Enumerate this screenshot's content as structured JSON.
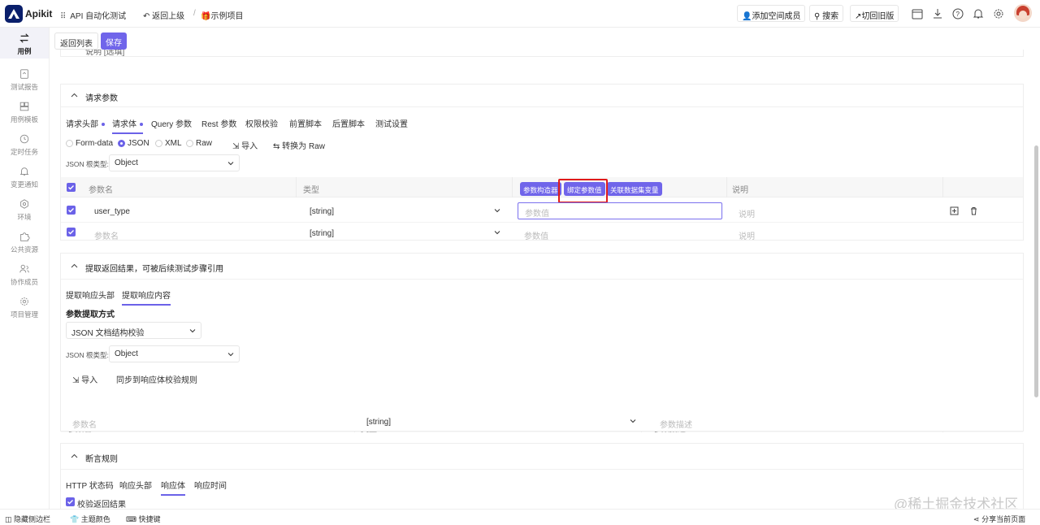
{
  "app": {
    "brand": "Apikit",
    "project": "API 自动化测试",
    "back_up": "返回上级",
    "breadcrumb": "示例项目"
  },
  "topbar": {
    "add_member": "添加空间成员",
    "search": "搜索",
    "switch_old": "切回旧版"
  },
  "sidebar": {
    "items": [
      {
        "label": "用例",
        "icon": "swap-icon"
      },
      {
        "label": "测试报告",
        "icon": "report-icon"
      },
      {
        "label": "用例模板",
        "icon": "template-icon"
      },
      {
        "label": "定时任务",
        "icon": "clock-icon"
      },
      {
        "label": "变更通知",
        "icon": "bell-icon"
      },
      {
        "label": "环境",
        "icon": "environment-icon"
      },
      {
        "label": "公共资源",
        "icon": "puzzle-icon"
      },
      {
        "label": "协作成员",
        "icon": "users-icon"
      },
      {
        "label": "项目管理",
        "icon": "settings-icon"
      }
    ]
  },
  "actions": {
    "back_list": "返回列表",
    "save": "保存"
  },
  "desc_section": {
    "title": "说明 [选填]"
  },
  "request_params": {
    "title": "请求参数",
    "tabs": [
      "请求头部",
      "请求体",
      "Query 参数",
      "Rest 参数",
      "权限校验",
      "前置脚本",
      "后置脚本",
      "测试设置"
    ],
    "body_types": [
      "Form-data",
      "JSON",
      "XML",
      "Raw"
    ],
    "import": "导入",
    "convert_raw": "转换为 Raw",
    "root_type_label": "JSON 根类型:",
    "root_type_value": "Object",
    "columns": {
      "name": "参数名",
      "type": "类型",
      "desc": "说明"
    },
    "value_buttons": [
      "参数构造器",
      "绑定参数值",
      "关联数据集变量"
    ],
    "rows": [
      {
        "name": "user_type",
        "type": "[string]",
        "value_placeholder": "参数值",
        "desc": "说明"
      },
      {
        "name": "参数名",
        "type": "[string]",
        "value_placeholder": "参数值",
        "desc": "说明"
      }
    ]
  },
  "extract": {
    "title": "提取返回结果，可被后续测试步骤引用",
    "tabs": [
      "提取响应头部",
      "提取响应内容"
    ],
    "method_label": "参数提取方式",
    "method_value": "JSON 文档结构校验",
    "root_type_label": "JSON 根类型:",
    "root_type_value": "Object",
    "import": "导入",
    "sync": "同步到响应体校验规则",
    "columns": {
      "name": "参数名",
      "type": "类型",
      "desc": "参数描述"
    },
    "row": {
      "name": "参数名",
      "type": "[string]",
      "desc": "参数描述"
    }
  },
  "assert": {
    "title": "断言规则",
    "tabs": [
      "HTTP 状态码",
      "响应头部",
      "响应体",
      "响应时间"
    ],
    "check_label": "校验返回结果"
  },
  "bottombar": {
    "hide_sidebar": "隐藏侧边栏",
    "theme": "主题颜色",
    "shortcuts": "快捷键",
    "share": "分享当前页面"
  },
  "watermark": "@稀土掘金技术社区",
  "colors": {
    "accent": "#6b62e8",
    "highlight": "#e01b1b",
    "brand": "#0a1f6b"
  }
}
